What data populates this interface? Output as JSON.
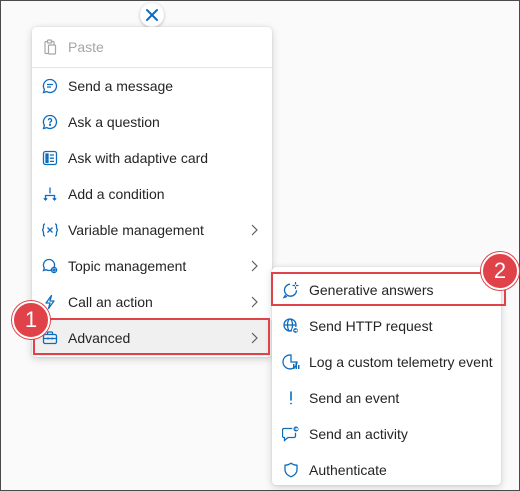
{
  "colors": {
    "accent": "#0f6cbd",
    "highlight": "#e0424a",
    "text": "#242424",
    "disabled": "#a6a6a6"
  },
  "close_icon": "close-icon",
  "main_menu": {
    "items": [
      {
        "label": "Paste",
        "icon": "paste-icon",
        "disabled": true
      },
      {
        "label": "Send a message",
        "icon": "chat-message-icon"
      },
      {
        "label": "Ask a question",
        "icon": "chat-question-icon"
      },
      {
        "label": "Ask with adaptive card",
        "icon": "adaptive-card-icon"
      },
      {
        "label": "Add a condition",
        "icon": "branch-icon"
      },
      {
        "label": "Variable management",
        "icon": "variable-icon",
        "submenu": true
      },
      {
        "label": "Topic management",
        "icon": "topic-icon",
        "submenu": true
      },
      {
        "label": "Call an action",
        "icon": "lightning-icon",
        "submenu": true
      },
      {
        "label": "Advanced",
        "icon": "toolbox-icon",
        "submenu": true,
        "active": true
      }
    ]
  },
  "sub_menu": {
    "items": [
      {
        "label": "Generative answers",
        "icon": "sparkle-chat-icon"
      },
      {
        "label": "Send HTTP request",
        "icon": "globe-icon"
      },
      {
        "label": "Log a custom telemetry event",
        "icon": "telemetry-icon"
      },
      {
        "label": "Send an event",
        "icon": "exclamation-icon"
      },
      {
        "label": "Send an activity",
        "icon": "chat-activity-icon"
      },
      {
        "label": "Authenticate",
        "icon": "shield-icon"
      }
    ]
  },
  "callouts": {
    "step1": "1",
    "step2": "2"
  }
}
